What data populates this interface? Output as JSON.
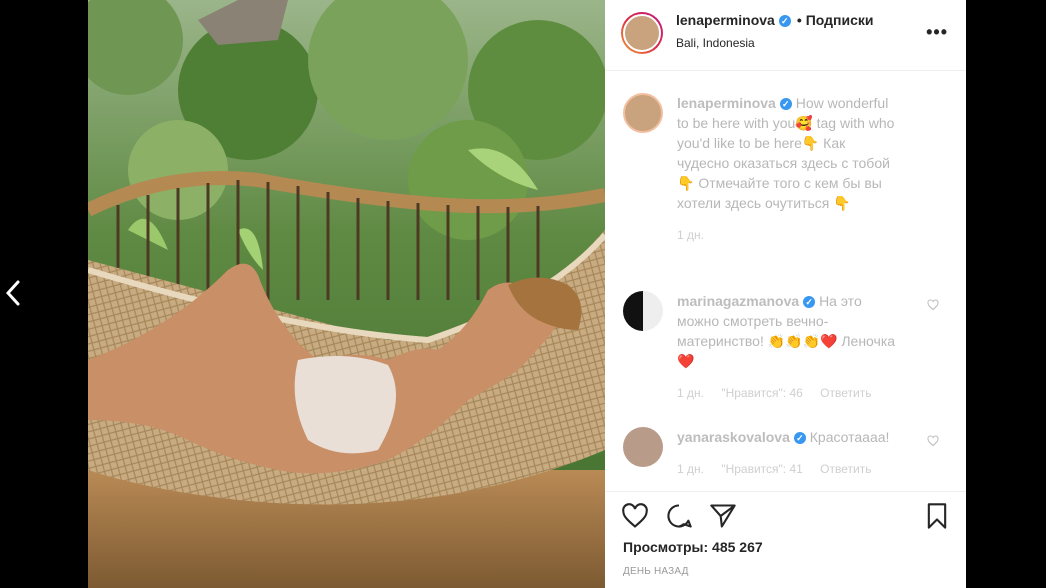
{
  "header": {
    "username": "lenaperminova",
    "verified_icon": "verified-badge-icon",
    "dot": "•",
    "follow_label": "Подписки",
    "location": "Bali, Indonesia",
    "more_label": "•••"
  },
  "caption": {
    "username": "lenaperminova",
    "text": "How wonderful to be here with you🥰 tag with who you'd like to be here👇 Как чудесно оказаться здесь с тобой👇 Отмечайте того с кем бы вы хотели здесь очутиться 👇",
    "time": "1 дн."
  },
  "comments": [
    {
      "username": "marinagazmanova",
      "text": "На это можно смотреть вечно- материнство! 👏👏👏❤️ Леночка ❤️",
      "time": "1 дн.",
      "likes": "\"Нравится\": 46",
      "reply": "Ответить"
    },
    {
      "username": "yanaraskovalova",
      "text": "Красотаааа!",
      "time": "1 дн.",
      "likes": "\"Нравится\": 41",
      "reply": "Ответить"
    }
  ],
  "actions": {
    "like_icon": "heart-icon",
    "comment_icon": "comment-icon",
    "share_icon": "share-icon",
    "save_icon": "bookmark-icon"
  },
  "views": "Просмотры: 485 267",
  "posted_ago": "день назад",
  "colors": {
    "verified": "#3897f0",
    "text": "#262626",
    "muted": "#b7b7b7"
  }
}
